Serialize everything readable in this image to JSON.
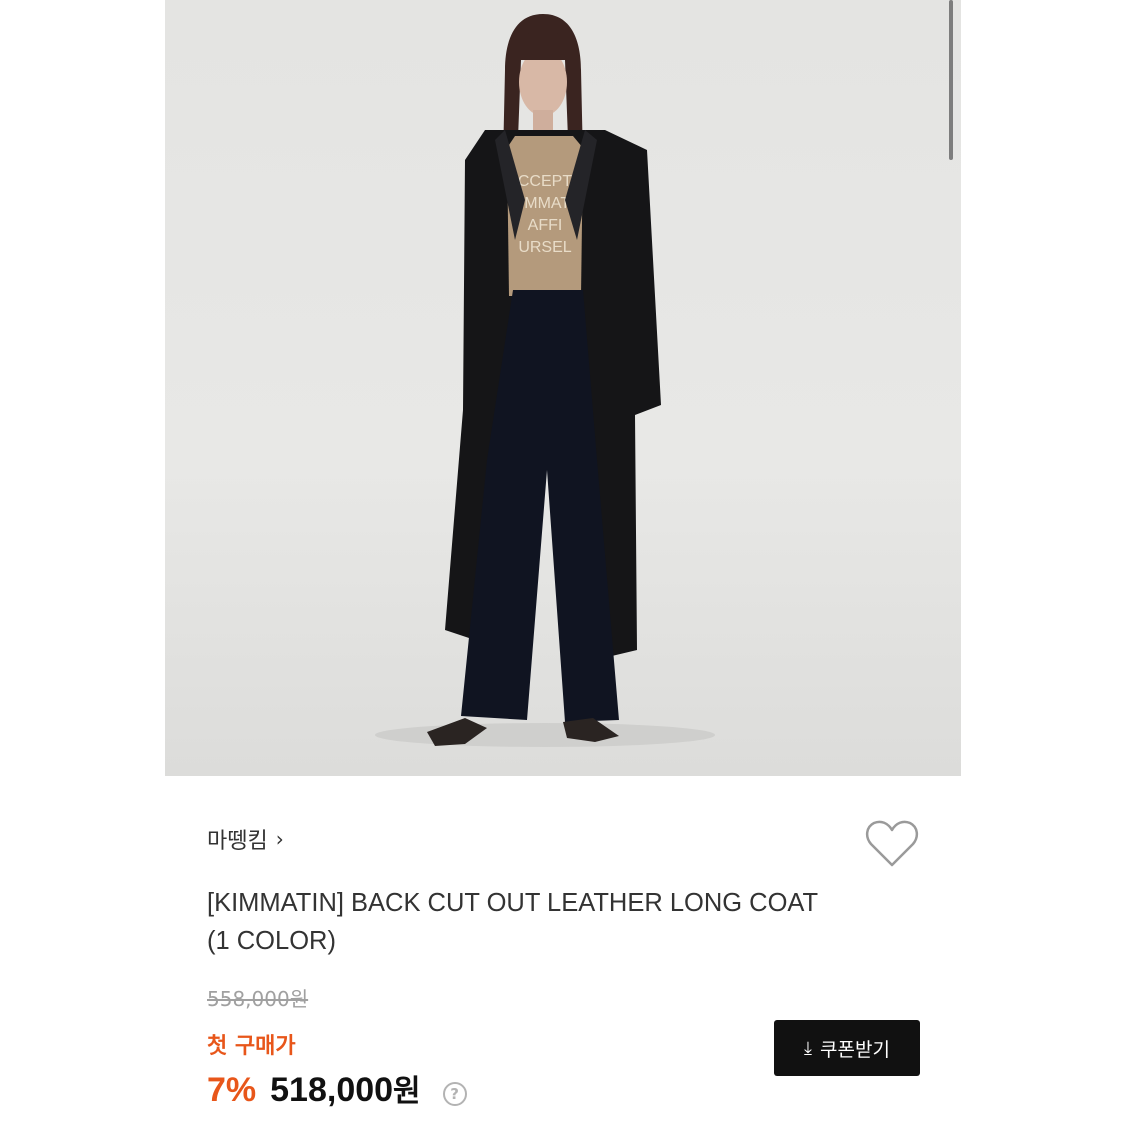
{
  "product": {
    "brand_name": "마뗑킴",
    "brand_chevron": "›",
    "title": "[KIMMATIN] BACK CUT OUT LEATHER LONG COAT (1 COLOR)",
    "original_price": "558,000원",
    "first_purchase_label": "첫 구매가",
    "discount_rate": "7%",
    "sale_price_number": "518,000",
    "sale_price_unit": "원",
    "help_icon_glyph": "?",
    "image_icon": "model-photo"
  },
  "actions": {
    "coupon_label": "쿠폰받기",
    "coupon_icon": "download-icon",
    "coupon_icon_glyph": "⤓",
    "wishlist_icon": "heart-icon"
  },
  "colors": {
    "accent": "#e8561a",
    "button_bg": "#111111",
    "text_primary": "#333333",
    "text_muted": "#a0a0a0"
  }
}
